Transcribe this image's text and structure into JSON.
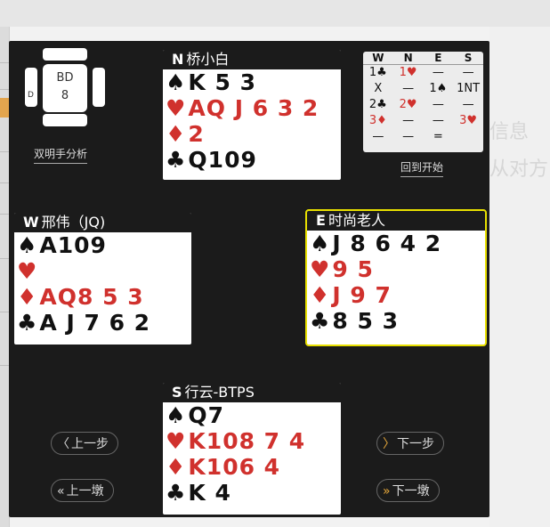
{
  "board": {
    "label": "BD",
    "number": "8",
    "dealer_mark": "D"
  },
  "links": {
    "double_dummy": "双明手分析",
    "restart": "回到开始"
  },
  "auction": {
    "headers": [
      "W",
      "N",
      "E",
      "S"
    ],
    "rows": [
      [
        {
          "t": "1♣",
          "c": "blk"
        },
        {
          "t": "1♥",
          "c": "red"
        },
        {
          "t": "—",
          "c": "blk"
        },
        {
          "t": "—",
          "c": "blk"
        }
      ],
      [
        {
          "t": "X",
          "c": "blk"
        },
        {
          "t": "—",
          "c": "blk"
        },
        {
          "t": "1♠",
          "c": "blk"
        },
        {
          "t": "1NT",
          "c": "blk"
        }
      ],
      [
        {
          "t": "2♣",
          "c": "blk"
        },
        {
          "t": "2♥",
          "c": "red"
        },
        {
          "t": "—",
          "c": "blk"
        },
        {
          "t": "—",
          "c": "blk"
        }
      ],
      [
        {
          "t": "3♦",
          "c": "red"
        },
        {
          "t": "—",
          "c": "blk"
        },
        {
          "t": "—",
          "c": "blk"
        },
        {
          "t": "3♥",
          "c": "red"
        }
      ],
      [
        {
          "t": "—",
          "c": "blk"
        },
        {
          "t": "—",
          "c": "blk"
        },
        {
          "t": "=",
          "c": "blk"
        },
        {
          "t": "",
          "c": "blk"
        }
      ]
    ]
  },
  "hands": {
    "north": {
      "seat": "N",
      "name": "桥小白",
      "spades": "K 5 3",
      "hearts": "AQ J 6 3 2",
      "diamonds": "2",
      "clubs": "Q109"
    },
    "west": {
      "seat": "W",
      "name": "邢伟（JQ)",
      "spades": "A109",
      "hearts": "",
      "diamonds": "AQ8 5 3",
      "clubs": "A J 7 6 2"
    },
    "east": {
      "seat": "E",
      "name": "时尚老人",
      "spades": "J 8 6 4 2",
      "hearts": "9 5",
      "diamonds": "J 9 7",
      "clubs": "8 5 3"
    },
    "south": {
      "seat": "S",
      "name": "行云-BTPS",
      "spades": "Q7",
      "hearts": "K108 7 4",
      "diamonds": "K106 4",
      "clubs": "K 4"
    }
  },
  "suits": {
    "spade": "♠",
    "heart": "♥",
    "diamond": "♦",
    "club": "♣"
  },
  "nav": {
    "prev_step": "上一步",
    "next_step": "下一步",
    "prev_trick": "上一墩",
    "next_trick": "下一墩"
  },
  "background": {
    "ghost_text_1": "信息",
    "ghost_text_2": "从对方"
  }
}
